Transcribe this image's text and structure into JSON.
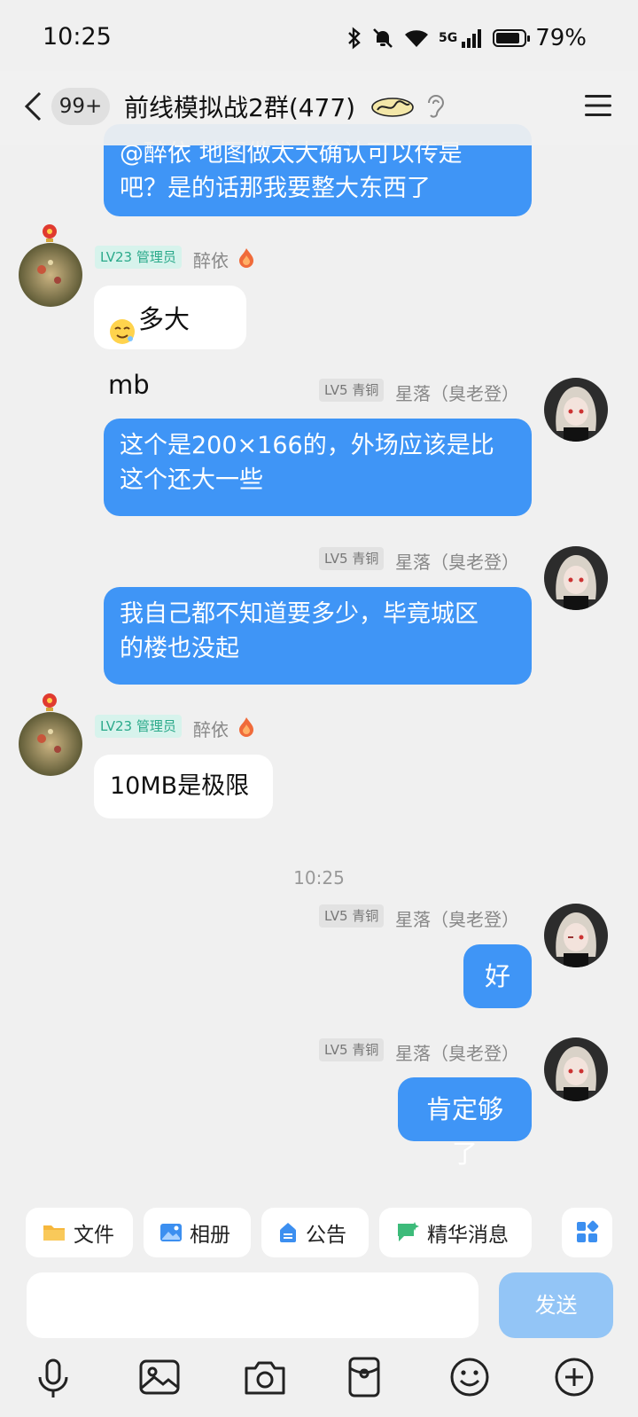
{
  "status": {
    "time": "10:25",
    "network": "5G",
    "battery": "79%",
    "battery_level": 0.79
  },
  "header": {
    "unread": "99+",
    "title": "前线模拟战2群(477)"
  },
  "messages": {
    "top_partial": "@醉依 地图做太大确认可以传是吧？是的话那我要整大东西了",
    "top_line1": "@醉依 地图做太大确认可以传是",
    "top_line2": "吧？是的话那我要整大东西了",
    "m1": {
      "level": "LV23 管理员",
      "nick": "醉依",
      "text": "多大mb"
    },
    "m2": {
      "level": "LV5 青铜",
      "nick": "星落（臭老登）",
      "line1": "这个是200×166的，外场应该是比",
      "line2": "这个还大一些"
    },
    "m3": {
      "level": "LV5 青铜",
      "nick": "星落（臭老登）",
      "line1": "我自己都不知道要多少，毕竟城区",
      "line2": "的楼也没起"
    },
    "m4": {
      "level": "LV23 管理员",
      "nick": "醉依",
      "text": "10MB是极限"
    },
    "time_sep": "10:25",
    "m5": {
      "level": "LV5 青铜",
      "nick": "星落（臭老登）",
      "text": "好"
    },
    "m6": {
      "level": "LV5 青铜",
      "nick": "星落（臭老登）",
      "text": "肯定够了"
    }
  },
  "toolbar": {
    "file": "文件",
    "album": "相册",
    "notice": "公告",
    "essence": "精华消息"
  },
  "composer": {
    "send": "发送"
  },
  "colors": {
    "bubble_me": "#3f95f6",
    "send_disabled": "#93c5f6",
    "admin_badge": "#2aa98a"
  }
}
